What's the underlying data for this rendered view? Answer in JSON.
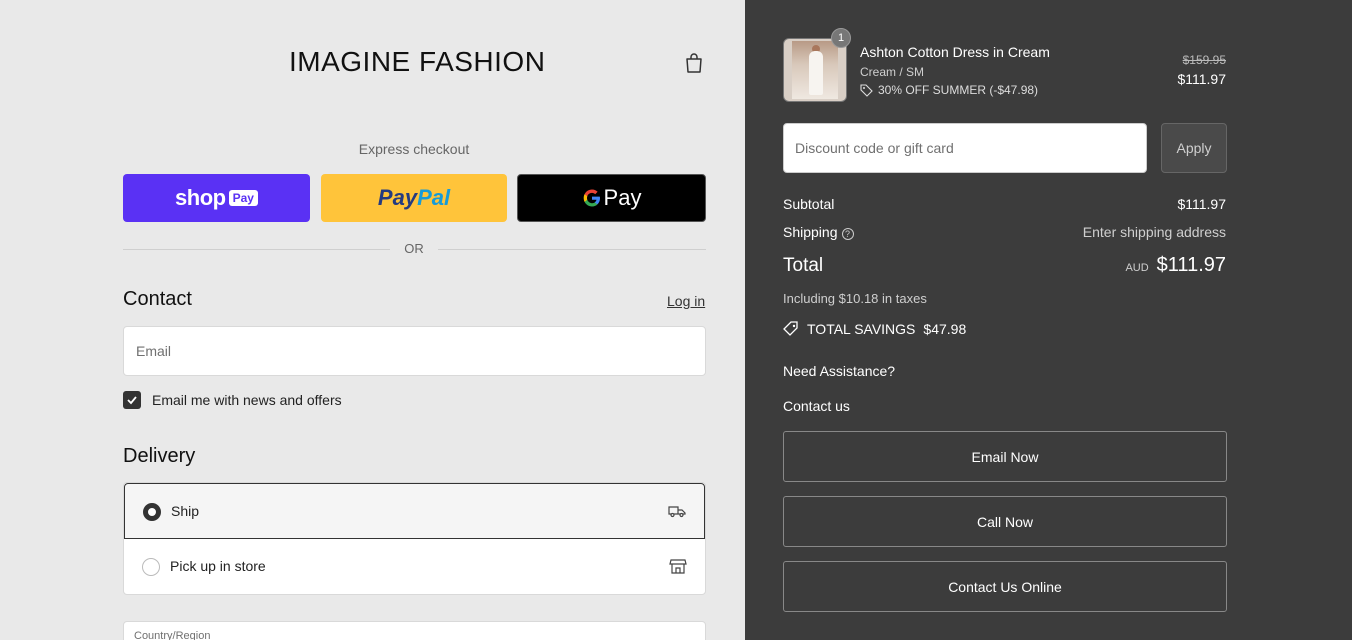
{
  "brand": "IMAGINE FASHION",
  "express": {
    "label": "Express checkout",
    "shop_text": "shop",
    "shop_pay": "Pay",
    "paypal_1": "Pay",
    "paypal_2": "Pal",
    "gpay_text": "Pay",
    "or": "OR"
  },
  "contact": {
    "heading": "Contact",
    "login": "Log in",
    "email_placeholder": "Email",
    "newsletter_label": "Email me with news and offers",
    "newsletter_checked": true
  },
  "delivery": {
    "heading": "Delivery",
    "options": [
      {
        "label": "Ship",
        "selected": true
      },
      {
        "label": "Pick up in store",
        "selected": false
      }
    ],
    "country_label": "Country/Region"
  },
  "summary": {
    "product": {
      "name": "Ashton Cotton Dress in Cream",
      "variant": "Cream / SM",
      "discount": "30% OFF SUMMER (-$47.98)",
      "old_price": "$159.95",
      "price": "$111.97",
      "quantity": "1"
    },
    "discount_placeholder": "Discount code or gift card",
    "apply_label": "Apply",
    "subtotal_label": "Subtotal",
    "subtotal_value": "$111.97",
    "shipping_label": "Shipping",
    "shipping_value": "Enter shipping address",
    "total_label": "Total",
    "currency": "AUD",
    "total_value": "$111.97",
    "taxes": "Including $10.18 in taxes",
    "savings_label": "TOTAL SAVINGS",
    "savings_value": "$47.98"
  },
  "assistance": {
    "heading": "Need Assistance?",
    "contact_us": "Contact us",
    "buttons": [
      "Email Now",
      "Call Now",
      "Contact Us Online"
    ]
  },
  "colors": {
    "shop_pay": "#5a31f4",
    "paypal": "#ffc43a",
    "sidebar_bg": "#3c3c3c"
  }
}
